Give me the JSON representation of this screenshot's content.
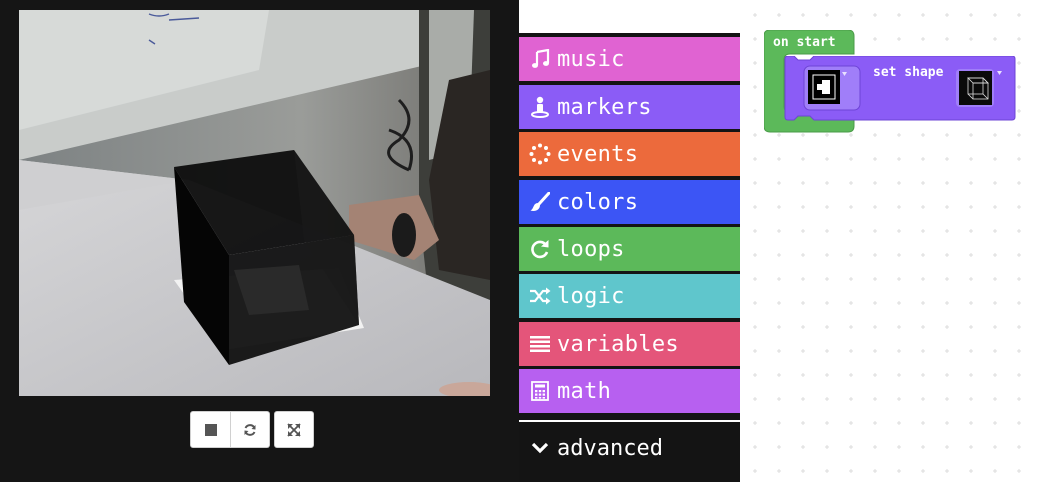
{
  "simulator": {
    "controls": [
      {
        "name": "stop",
        "icon": "stop-icon"
      },
      {
        "name": "restart",
        "icon": "restart-icon"
      },
      {
        "name": "fullscreen",
        "icon": "fullscreen-icon"
      }
    ]
  },
  "toolbox": {
    "categories": [
      {
        "label": "music",
        "icon": "music-note-icon",
        "color": "#e063d2"
      },
      {
        "label": "markers",
        "icon": "marker-icon",
        "color": "#8b5cf6"
      },
      {
        "label": "events",
        "icon": "events-icon",
        "color": "#ec6a3c"
      },
      {
        "label": "colors",
        "icon": "paintbrush-icon",
        "color": "#3c55f5"
      },
      {
        "label": "loops",
        "icon": "loop-icon",
        "color": "#5cb95a"
      },
      {
        "label": "logic",
        "icon": "shuffle-icon",
        "color": "#5fc6cc"
      },
      {
        "label": "variables",
        "icon": "list-icon",
        "color": "#e4557a"
      },
      {
        "label": "math",
        "icon": "calculator-icon",
        "color": "#b760f0"
      }
    ],
    "advanced_label": "advanced",
    "advanced_icon": "chevron-down-icon"
  },
  "workspace": {
    "on_start_label": "on start",
    "on_start_color": "#5cb95a",
    "set_shape_label": "set shape",
    "set_shape_color": "#8b5cf6",
    "marker_icon": "marker-pattern-icon",
    "shape_icon": "cube-icon"
  }
}
